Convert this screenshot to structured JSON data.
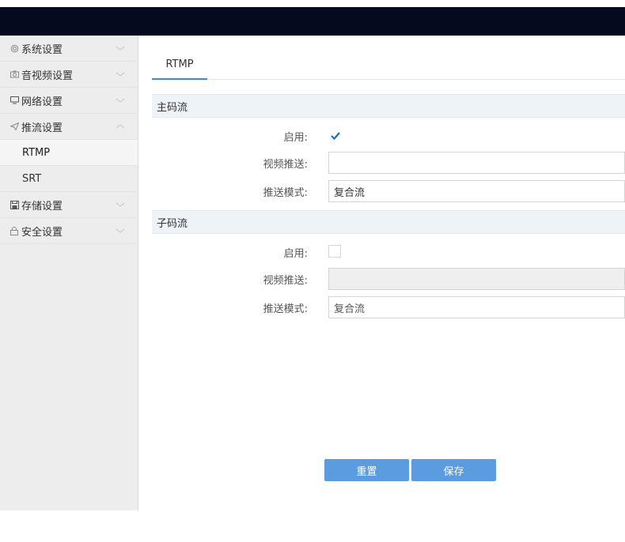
{
  "sidebar": {
    "items": [
      {
        "label": "系统设置",
        "icon": "gear-icon",
        "expanded": false
      },
      {
        "label": "音视频设置",
        "icon": "camera-icon",
        "expanded": false
      },
      {
        "label": "网络设置",
        "icon": "monitor-icon",
        "expanded": false
      },
      {
        "label": "推流设置",
        "icon": "send-icon",
        "expanded": true,
        "children": [
          {
            "label": "RTMP",
            "active": true
          },
          {
            "label": "SRT",
            "active": false
          }
        ]
      },
      {
        "label": "存储设置",
        "icon": "save-icon",
        "expanded": false
      },
      {
        "label": "安全设置",
        "icon": "lock-icon",
        "expanded": false
      }
    ]
  },
  "main": {
    "tabs": [
      {
        "label": "RTMP",
        "active": true
      }
    ],
    "main_stream": {
      "title": "主码流",
      "enable_label": "启用:",
      "enabled": true,
      "video_push_label": "视频推送:",
      "video_push_value": "",
      "push_mode_label": "推送模式:",
      "push_mode_value": "复合流"
    },
    "sub_stream": {
      "title": "子码流",
      "enable_label": "启用:",
      "enabled": false,
      "video_push_label": "视频推送:",
      "video_push_value": "",
      "push_mode_label": "推送模式:",
      "push_mode_value": "复合流"
    },
    "buttons": {
      "reset_label": "重置",
      "save_label": "保存"
    }
  },
  "colors": {
    "topbar": "#050a1e",
    "accent": "#3a8be0",
    "button": "#5b9be0",
    "checkmark": "#1f6fb5"
  }
}
